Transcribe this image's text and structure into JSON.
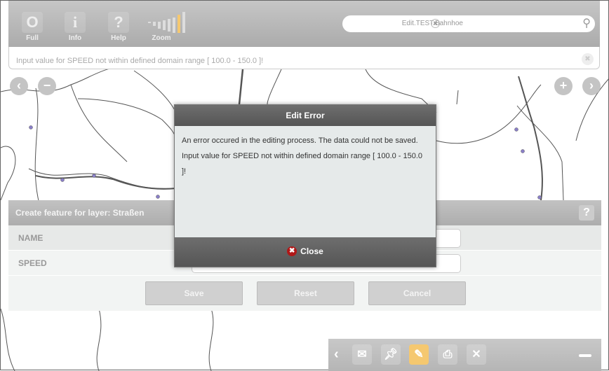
{
  "toolbar": {
    "full": "Full",
    "info": "Info",
    "help": "Help",
    "zoom": "Zoom",
    "search_value": "Edit.TEST.Bahnhoe"
  },
  "message": "Input value for SPEED not within defined domain range [ 100.0 - 150.0 ]!",
  "form": {
    "title": "Create feature for layer: Straßen",
    "help": "?",
    "fields": [
      {
        "label": "NAME",
        "value": ""
      },
      {
        "label": "SPEED",
        "value": ""
      }
    ],
    "save": "Save",
    "reset": "Reset",
    "cancel": "Cancel"
  },
  "dialog": {
    "title": "Edit Error",
    "line1": "An error occured in the editing process. The data could not be saved.",
    "line2": "Input value for SPEED not within defined domain range [ 100.0 - 150.0 ]!",
    "close": "Close"
  },
  "colors": {
    "accent": "#f5c870",
    "error": "#b01818"
  }
}
